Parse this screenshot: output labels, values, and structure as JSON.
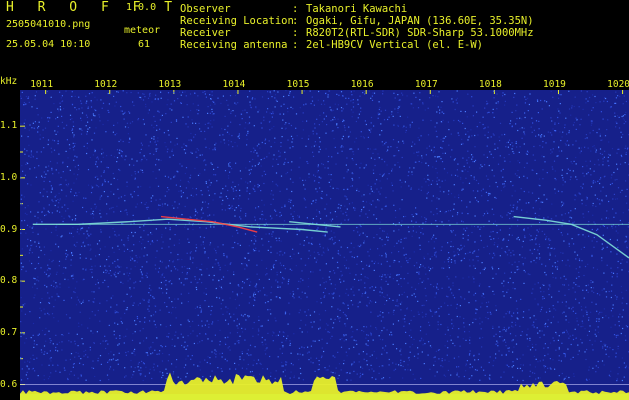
{
  "header": {
    "app_name": "H R O F F T",
    "version": "1.0.0",
    "filename": "2505041010.png",
    "meteor_label": "meteor",
    "timestamp": "25.05.04 10:10",
    "meteor_count": "61",
    "fields": [
      {
        "key": "Observer",
        "value": "Takanori Kawachi"
      },
      {
        "key": "Receiving Location",
        "value": "Ogaki, Gifu, JAPAN (136.60E, 35.35N)"
      },
      {
        "key": "Receiver",
        "value": "R820T2(RTL-SDR) SDR-Sharp 53.1000MHz"
      },
      {
        "key": "Receiving antenna",
        "value": "2el-HB9CV Vertical (el. E-W)"
      }
    ]
  },
  "colors": {
    "text": "#e8f02a",
    "background": "#16208a",
    "noise_bright": "#2a40c8",
    "trace": "#7fe0d8",
    "trace_hot": "#ff4040",
    "bottom_band": "#e8f02a",
    "bottom_base": "#19d9e0"
  },
  "chart_data": {
    "type": "heatmap",
    "xlabel": "",
    "ylabel": "kHz",
    "x_ticks": [
      "1011",
      "1012",
      "1013",
      "1014",
      "1015",
      "1016",
      "1017",
      "1018",
      "1019",
      "1020"
    ],
    "y_ticks": [
      "1.1",
      "1.0",
      "0.9",
      "0.8",
      "0.7",
      "0.6"
    ],
    "y_ticks_minor": [
      "1.05",
      "0.95",
      "0.85",
      "0.75",
      "0.65"
    ],
    "ylim": [
      0.57,
      1.17
    ],
    "xlim": [
      1010.6,
      1020.1
    ],
    "carrier_freq_khz": 0.91,
    "meteor_traces": [
      {
        "x": [
          1010.8,
          1011.5,
          1012.3,
          1012.9,
          1013.5,
          1014.2,
          1015.0,
          1015.4
        ],
        "y": [
          0.91,
          0.91,
          0.915,
          0.92,
          0.915,
          0.905,
          0.9,
          0.895
        ]
      },
      {
        "x": [
          1012.8,
          1013.2,
          1013.6,
          1014.0,
          1014.3
        ],
        "y": [
          0.925,
          0.92,
          0.915,
          0.905,
          0.895
        ]
      },
      {
        "x": [
          1014.8,
          1015.2,
          1015.6
        ],
        "y": [
          0.915,
          0.91,
          0.905
        ]
      },
      {
        "x": [
          1018.3,
          1018.8,
          1019.2,
          1019.6,
          1020.1
        ],
        "y": [
          0.925,
          0.918,
          0.91,
          0.89,
          0.845
        ]
      }
    ],
    "reference_lines_khz": [
      0.58,
      0.6
    ]
  }
}
